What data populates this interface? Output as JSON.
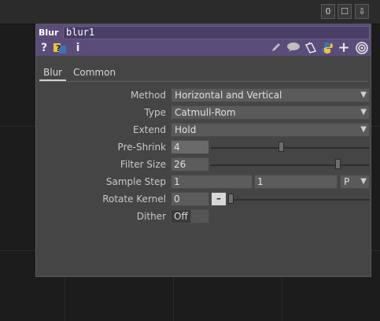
{
  "network": {
    "top_buttons": [
      {
        "label": "0",
        "icon": "number-zero"
      },
      {
        "label": "☐",
        "icon": "window-square-icon"
      },
      {
        "label": "⇩",
        "icon": "download-arrow-icon"
      }
    ]
  },
  "panel": {
    "op_type": "Blur",
    "op_name": "blur1",
    "header_icons": [
      "help-icon",
      "python-help-icon",
      "info-icon",
      "edit-icon",
      "comment-icon",
      "clone-icon",
      "python-icon",
      "add-icon",
      "target-icon"
    ],
    "tabs": [
      "Blur",
      "Common"
    ],
    "active_tab": "Blur",
    "params": {
      "method": {
        "label": "Method",
        "value": "Horizontal and Vertical"
      },
      "type": {
        "label": "Type",
        "value": "Catmull-Rom"
      },
      "extend": {
        "label": "Extend",
        "value": "Hold"
      },
      "pre_shrink": {
        "label": "Pre-Shrink",
        "value": "4",
        "slider_level": 0.44
      },
      "filter_size": {
        "label": "Filter Size",
        "value": "26",
        "slider_level": 0.81
      },
      "sample_step": {
        "label": "Sample Step",
        "value1": "1",
        "value2": "1",
        "mode": "P"
      },
      "rotate_kernel": {
        "label": "Rotate Kernel",
        "value": "0",
        "slider_level": 0.0
      },
      "dither": {
        "label": "Dither",
        "value": "Off"
      }
    },
    "colors": {
      "header": "#5b4c7a",
      "panel_bg": "#454545"
    }
  }
}
